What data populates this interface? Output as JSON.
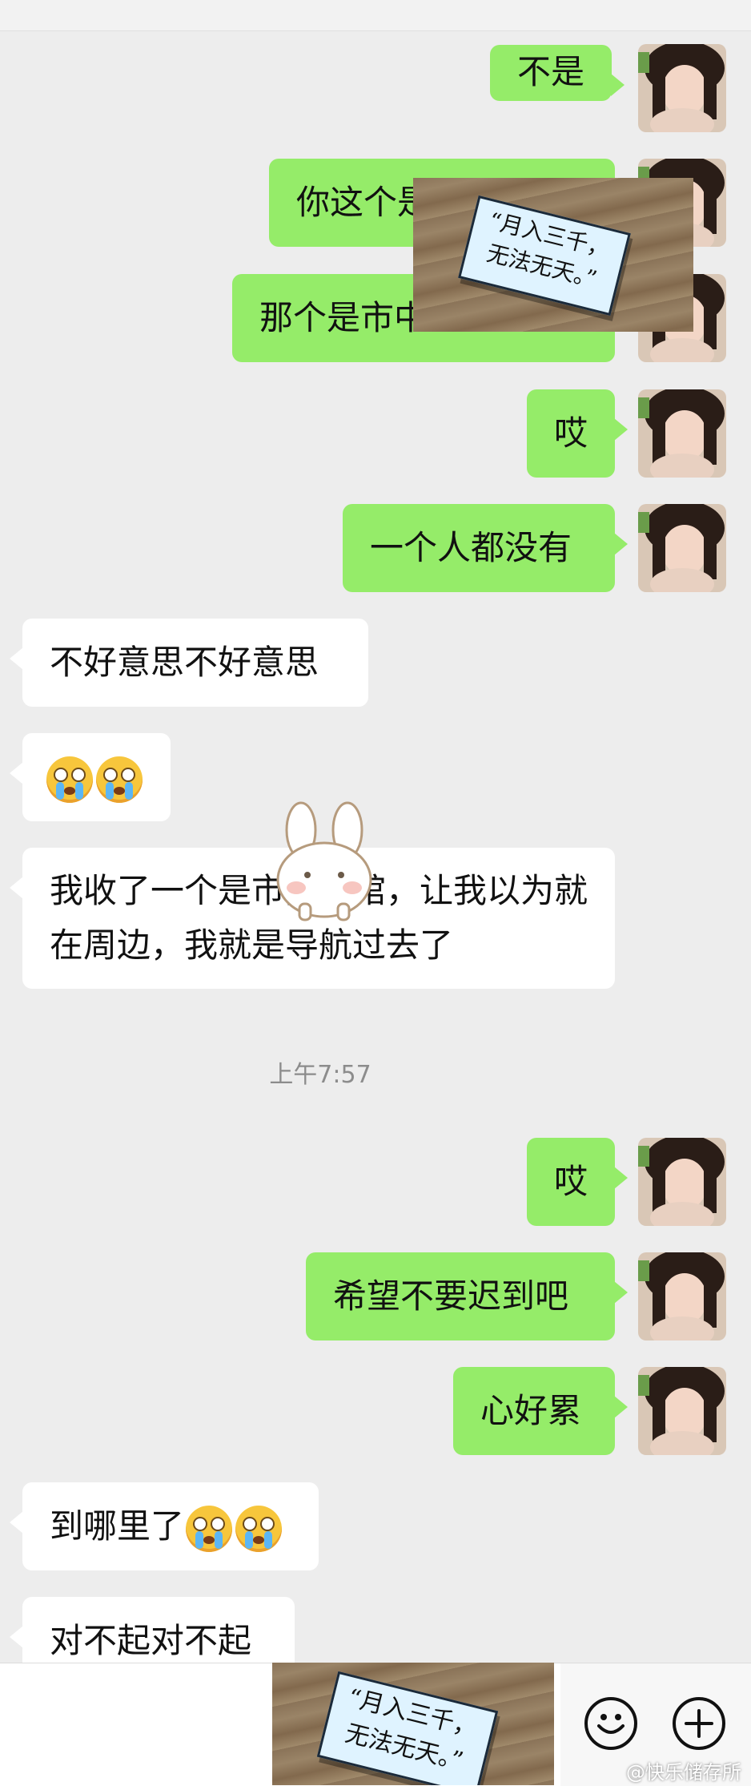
{
  "messages": [
    {
      "text": "不是"
    },
    {
      "text": "你这个是"
    },
    {
      "text": "那个是市中心"
    },
    {
      "text": "哎"
    },
    {
      "text": "一个人都没有"
    },
    {
      "text": "不好意思不好意思"
    },
    {
      "text": ""
    },
    {
      "text": "我收了一个是市图书馆，让我以为就在周边，我就是导航过去了"
    },
    {
      "text": "哎"
    },
    {
      "text": "希望不要迟到吧"
    },
    {
      "text": "心好累"
    },
    {
      "text": "到哪里了"
    },
    {
      "text": "对不起对不起"
    }
  ],
  "timestamp": "上午7:57",
  "sticker": {
    "line1": "“月入三千，",
    "line2": "无法无天。”"
  },
  "input": {
    "emoji_icon": "smiley-icon",
    "add_icon": "plus-icon"
  },
  "watermark": "@快乐储存所",
  "colors": {
    "sent_bubble": "#95ec69",
    "recv_bubble": "#ffffff",
    "background": "#ededed"
  }
}
